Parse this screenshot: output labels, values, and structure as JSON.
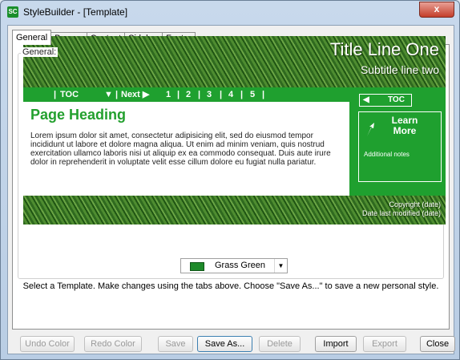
{
  "window": {
    "app_icon_text": "SC",
    "title": "StyleBuilder - [Template]",
    "close_glyph": "x"
  },
  "tabs": [
    "General",
    "Banner",
    "Content",
    "Sidebar",
    "Footer"
  ],
  "group_label": "General:",
  "preview": {
    "banner_title": "Title Line One",
    "banner_subtitle": "Subtitle line two",
    "nav": {
      "toc": "TOC",
      "arrow": "▼",
      "next": "Next ▶",
      "pages": [
        "1",
        "2",
        "3",
        "4",
        "5"
      ]
    },
    "page_heading": "Page Heading",
    "body_text": "Lorem ipsum dolor sit amet, consectetur adipisicing elit, sed do eiusmod tempor incididunt ut labore et dolore magna aliqua. Ut enim ad minim veniam, quis nostrud exercitation ullamco laboris nisi ut aliquip ex ea commodo consequat. Duis aute irure dolor in reprehenderit in voluptate velit esse cillum dolore eu fugiat nulla pariatur.",
    "sidebar_toc": "TOC",
    "sidebar_toc_arrow": "◀",
    "learn_more": "Learn More",
    "additional_notes": "Additional notes",
    "footer_copyright": "Copyright (date)",
    "footer_modified": "Date last modified (date)"
  },
  "template_select": {
    "value": "Grass Green",
    "swatch_color": "#1e8a2a"
  },
  "instructions": "Select a Template. Make changes using the tabs above. Choose \"Save As...\" to save a new personal style.",
  "buttons": {
    "undo_color": "Undo Color",
    "redo_color": "Redo Color",
    "save": "Save",
    "save_as": "Save As...",
    "delete": "Delete",
    "import": "Import",
    "export": "Export",
    "close": "Close"
  },
  "colors": {
    "accent_green": "#1fa02f",
    "heading_green": "#23a02e"
  }
}
